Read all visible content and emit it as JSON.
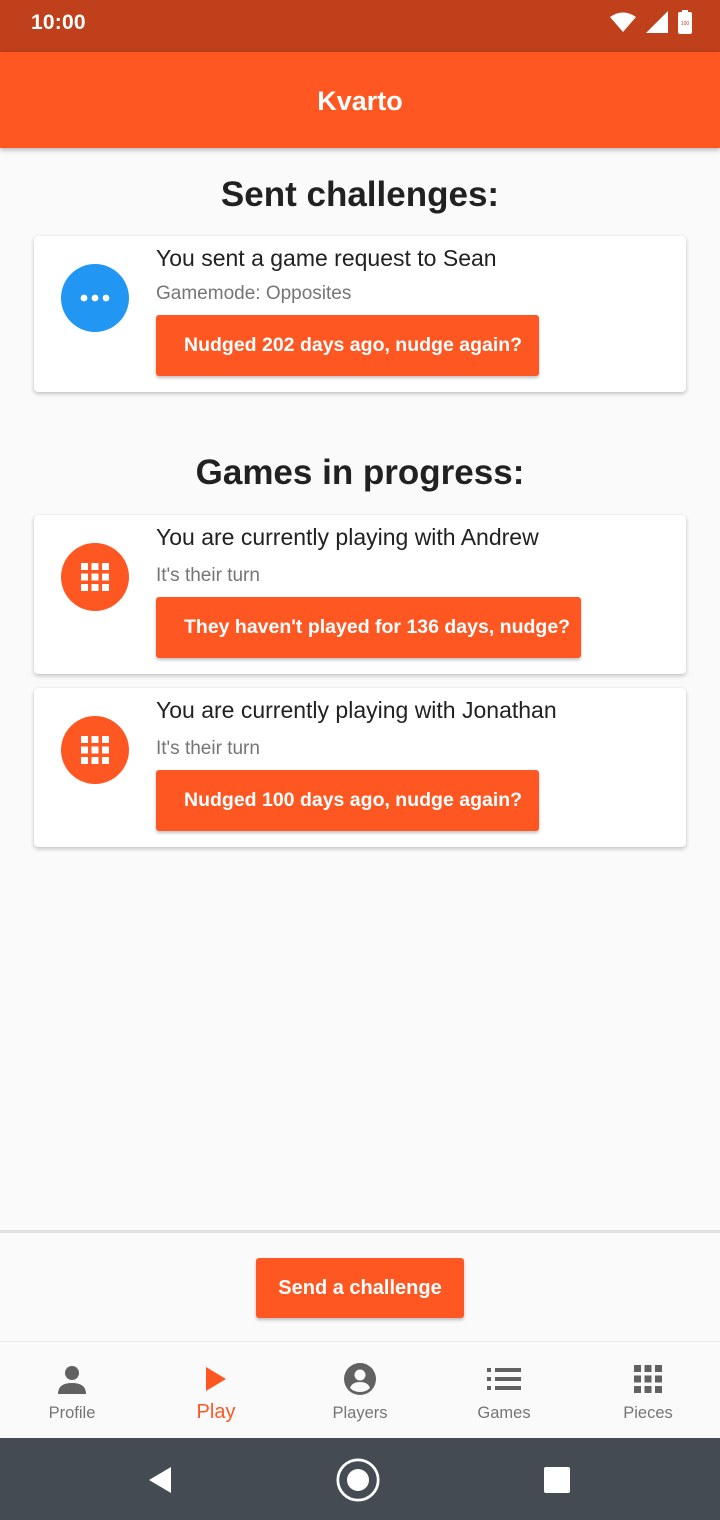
{
  "status_bar": {
    "time": "10:00",
    "battery": "100"
  },
  "app_bar": {
    "title": "Kvarto"
  },
  "sent_section": {
    "title": "Sent challenges:",
    "cards": [
      {
        "title": "You sent a game request to Sean",
        "subtitle": "Gamemode: Opposites",
        "button": "Nudged 202 days ago, nudge again?",
        "icon": "more-horiz-icon"
      }
    ]
  },
  "progress_section": {
    "title": "Games in progress:",
    "cards": [
      {
        "title": "You are currently playing with Andrew",
        "subtitle": "It's their turn",
        "button": "They haven't played for 136 days, nudge?",
        "icon": "grid-icon"
      },
      {
        "title": "You are currently playing with Jonathan",
        "subtitle": "It's their turn",
        "button": "Nudged 100 days ago, nudge again?",
        "icon": "grid-icon"
      }
    ]
  },
  "send_challenge": {
    "label": "Send a challenge"
  },
  "bottom_nav": {
    "items": [
      {
        "label": "Profile",
        "icon": "person-icon",
        "active": false
      },
      {
        "label": "Play",
        "icon": "play-icon",
        "active": true
      },
      {
        "label": "Players",
        "icon": "account-circle-icon",
        "active": false
      },
      {
        "label": "Games",
        "icon": "list-icon",
        "active": false
      },
      {
        "label": "Pieces",
        "icon": "grid-icon",
        "active": false
      }
    ]
  },
  "colors": {
    "primary": "#ff5722",
    "status_bar": "#bf401a",
    "accent_blue": "#2196f3",
    "system_nav": "#454b52"
  }
}
